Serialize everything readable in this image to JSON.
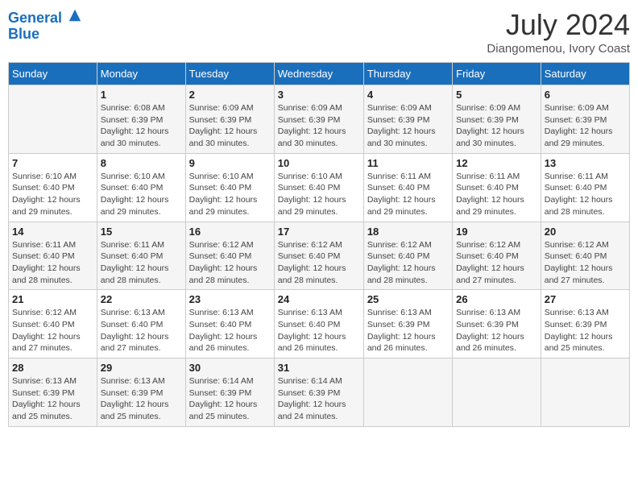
{
  "header": {
    "logo_line1": "General",
    "logo_line2": "Blue",
    "month_title": "July 2024",
    "subtitle": "Diangomenou, Ivory Coast"
  },
  "days_of_week": [
    "Sunday",
    "Monday",
    "Tuesday",
    "Wednesday",
    "Thursday",
    "Friday",
    "Saturday"
  ],
  "weeks": [
    [
      {
        "day": "",
        "info": ""
      },
      {
        "day": "1",
        "info": "Sunrise: 6:08 AM\nSunset: 6:39 PM\nDaylight: 12 hours\nand 30 minutes."
      },
      {
        "day": "2",
        "info": "Sunrise: 6:09 AM\nSunset: 6:39 PM\nDaylight: 12 hours\nand 30 minutes."
      },
      {
        "day": "3",
        "info": "Sunrise: 6:09 AM\nSunset: 6:39 PM\nDaylight: 12 hours\nand 30 minutes."
      },
      {
        "day": "4",
        "info": "Sunrise: 6:09 AM\nSunset: 6:39 PM\nDaylight: 12 hours\nand 30 minutes."
      },
      {
        "day": "5",
        "info": "Sunrise: 6:09 AM\nSunset: 6:39 PM\nDaylight: 12 hours\nand 30 minutes."
      },
      {
        "day": "6",
        "info": "Sunrise: 6:09 AM\nSunset: 6:39 PM\nDaylight: 12 hours\nand 29 minutes."
      }
    ],
    [
      {
        "day": "7",
        "info": "Sunrise: 6:10 AM\nSunset: 6:40 PM\nDaylight: 12 hours\nand 29 minutes."
      },
      {
        "day": "8",
        "info": "Sunrise: 6:10 AM\nSunset: 6:40 PM\nDaylight: 12 hours\nand 29 minutes."
      },
      {
        "day": "9",
        "info": "Sunrise: 6:10 AM\nSunset: 6:40 PM\nDaylight: 12 hours\nand 29 minutes."
      },
      {
        "day": "10",
        "info": "Sunrise: 6:10 AM\nSunset: 6:40 PM\nDaylight: 12 hours\nand 29 minutes."
      },
      {
        "day": "11",
        "info": "Sunrise: 6:11 AM\nSunset: 6:40 PM\nDaylight: 12 hours\nand 29 minutes."
      },
      {
        "day": "12",
        "info": "Sunrise: 6:11 AM\nSunset: 6:40 PM\nDaylight: 12 hours\nand 29 minutes."
      },
      {
        "day": "13",
        "info": "Sunrise: 6:11 AM\nSunset: 6:40 PM\nDaylight: 12 hours\nand 28 minutes."
      }
    ],
    [
      {
        "day": "14",
        "info": "Sunrise: 6:11 AM\nSunset: 6:40 PM\nDaylight: 12 hours\nand 28 minutes."
      },
      {
        "day": "15",
        "info": "Sunrise: 6:11 AM\nSunset: 6:40 PM\nDaylight: 12 hours\nand 28 minutes."
      },
      {
        "day": "16",
        "info": "Sunrise: 6:12 AM\nSunset: 6:40 PM\nDaylight: 12 hours\nand 28 minutes."
      },
      {
        "day": "17",
        "info": "Sunrise: 6:12 AM\nSunset: 6:40 PM\nDaylight: 12 hours\nand 28 minutes."
      },
      {
        "day": "18",
        "info": "Sunrise: 6:12 AM\nSunset: 6:40 PM\nDaylight: 12 hours\nand 28 minutes."
      },
      {
        "day": "19",
        "info": "Sunrise: 6:12 AM\nSunset: 6:40 PM\nDaylight: 12 hours\nand 27 minutes."
      },
      {
        "day": "20",
        "info": "Sunrise: 6:12 AM\nSunset: 6:40 PM\nDaylight: 12 hours\nand 27 minutes."
      }
    ],
    [
      {
        "day": "21",
        "info": "Sunrise: 6:12 AM\nSunset: 6:40 PM\nDaylight: 12 hours\nand 27 minutes."
      },
      {
        "day": "22",
        "info": "Sunrise: 6:13 AM\nSunset: 6:40 PM\nDaylight: 12 hours\nand 27 minutes."
      },
      {
        "day": "23",
        "info": "Sunrise: 6:13 AM\nSunset: 6:40 PM\nDaylight: 12 hours\nand 26 minutes."
      },
      {
        "day": "24",
        "info": "Sunrise: 6:13 AM\nSunset: 6:40 PM\nDaylight: 12 hours\nand 26 minutes."
      },
      {
        "day": "25",
        "info": "Sunrise: 6:13 AM\nSunset: 6:39 PM\nDaylight: 12 hours\nand 26 minutes."
      },
      {
        "day": "26",
        "info": "Sunrise: 6:13 AM\nSunset: 6:39 PM\nDaylight: 12 hours\nand 26 minutes."
      },
      {
        "day": "27",
        "info": "Sunrise: 6:13 AM\nSunset: 6:39 PM\nDaylight: 12 hours\nand 25 minutes."
      }
    ],
    [
      {
        "day": "28",
        "info": "Sunrise: 6:13 AM\nSunset: 6:39 PM\nDaylight: 12 hours\nand 25 minutes."
      },
      {
        "day": "29",
        "info": "Sunrise: 6:13 AM\nSunset: 6:39 PM\nDaylight: 12 hours\nand 25 minutes."
      },
      {
        "day": "30",
        "info": "Sunrise: 6:14 AM\nSunset: 6:39 PM\nDaylight: 12 hours\nand 25 minutes."
      },
      {
        "day": "31",
        "info": "Sunrise: 6:14 AM\nSunset: 6:39 PM\nDaylight: 12 hours\nand 24 minutes."
      },
      {
        "day": "",
        "info": ""
      },
      {
        "day": "",
        "info": ""
      },
      {
        "day": "",
        "info": ""
      }
    ]
  ]
}
